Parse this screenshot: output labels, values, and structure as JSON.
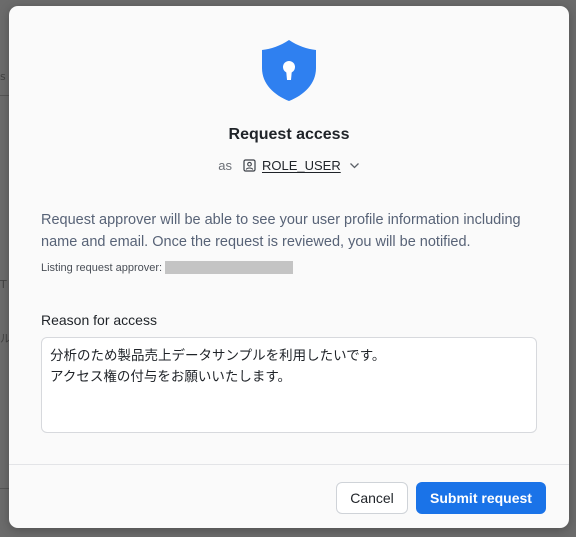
{
  "dialog": {
    "title": "Request access",
    "as_label": "as",
    "role": "ROLE_USER",
    "info_text": "Request approver will be able to see your user profile information including name and email. Once the request is reviewed, you will be notified.",
    "approver_label": "Listing request approver:",
    "reason_label": "Reason for access",
    "reason_value": "分析のため製品売上データサンプルを利用したいです。\nアクセス権の付与をお願いいたします。",
    "cancel_label": "Cancel",
    "submit_label": "Submit request"
  },
  "icons": {
    "header": "shield-lock-icon",
    "role": "user-badge-icon",
    "dropdown": "chevron-down-icon"
  },
  "colors": {
    "accent": "#1a73e8",
    "shield": "#2f80f0"
  }
}
